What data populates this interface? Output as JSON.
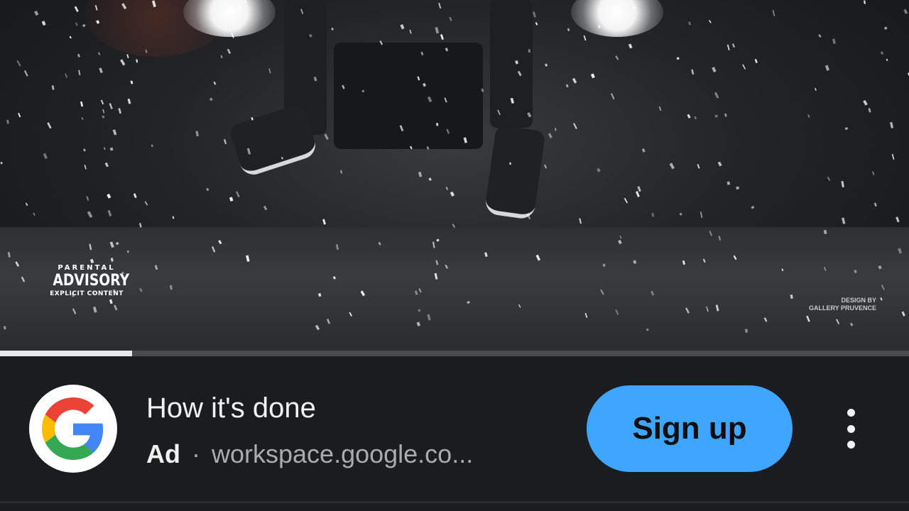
{
  "video": {
    "advisory": {
      "line1": "PARENTAL",
      "line2": "ADVISORY",
      "line3": "EXPLICIT CONTENT"
    },
    "credit": {
      "line1": "DESIGN BY",
      "line2": "GALLERY PRUVENCE"
    },
    "progress_fraction": 0.145
  },
  "ad": {
    "logo_icon": "google-g-icon",
    "title": "How it's done",
    "label": "Ad",
    "separator": "·",
    "domain": "workspace.google.co...",
    "cta_label": "Sign up",
    "cta_color": "#3ea6ff",
    "more_icon": "more-vertical-icon"
  }
}
